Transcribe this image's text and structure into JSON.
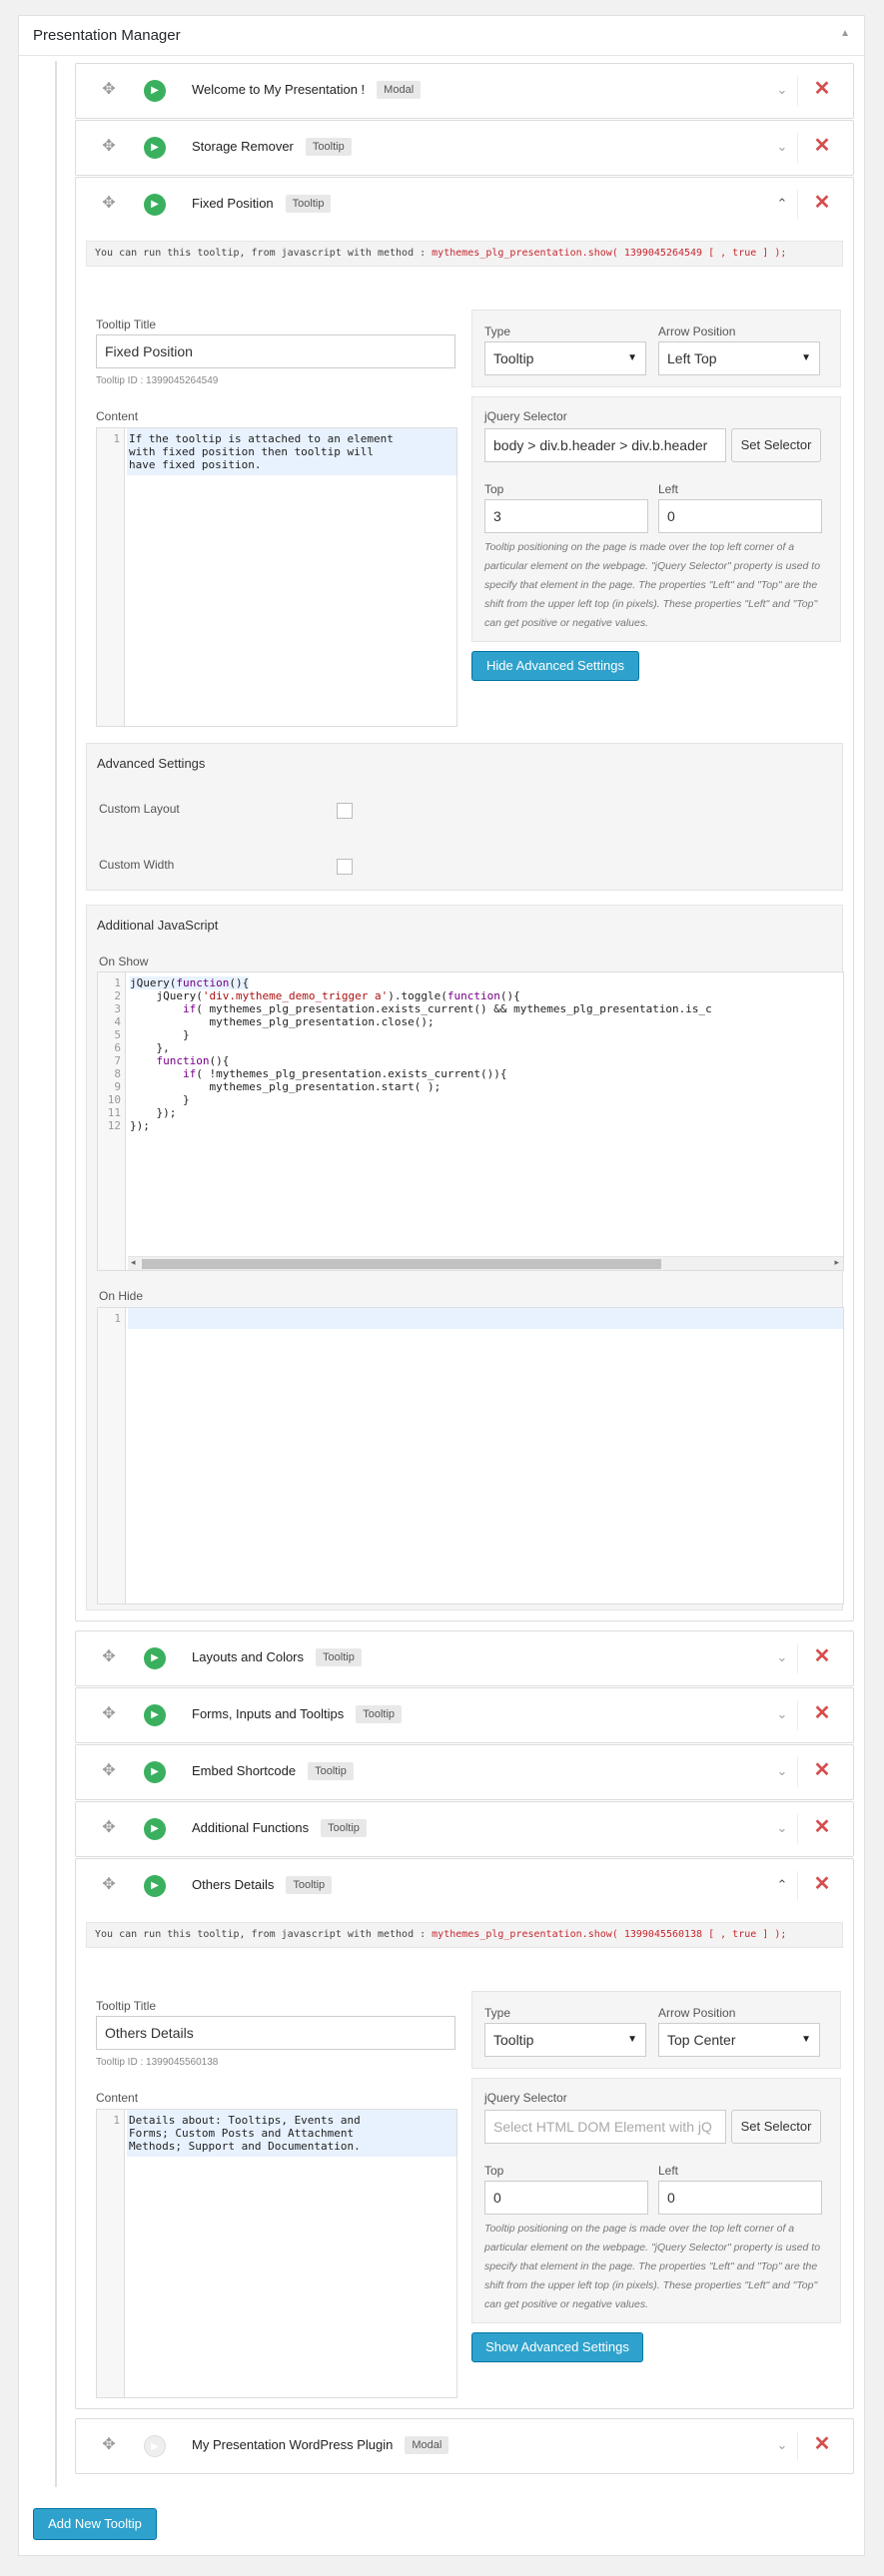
{
  "manager": {
    "title": "Presentation Manager"
  },
  "items": [
    {
      "title": "Welcome to My Presentation !",
      "badge": "Modal",
      "expanded": false,
      "enabled": true
    },
    {
      "title": "Storage Remover",
      "badge": "Tooltip",
      "expanded": false,
      "enabled": true
    },
    {
      "title": "Fixed Position",
      "badge": "Tooltip",
      "expanded": true,
      "enabled": true
    },
    {
      "title": "Layouts and Colors",
      "badge": "Tooltip",
      "expanded": false,
      "enabled": true
    },
    {
      "title": "Forms, Inputs and Tooltips",
      "badge": "Tooltip",
      "expanded": false,
      "enabled": true
    },
    {
      "title": "Embed Shortcode",
      "badge": "Tooltip",
      "expanded": false,
      "enabled": true
    },
    {
      "title": "Additional Functions",
      "badge": "Tooltip",
      "expanded": false,
      "enabled": true
    },
    {
      "title": "Others Details",
      "badge": "Tooltip",
      "expanded": true,
      "enabled": true
    },
    {
      "title": "My Presentation WordPress Plugin",
      "badge": "Modal",
      "expanded": false,
      "enabled": false
    }
  ],
  "fixed": {
    "info_prefix": "You can run this tooltip, from javascript with method : ",
    "info_method": "mythemes_plg_presentation.show( 1399045264549 [ , true ] );",
    "title_label": "Tooltip Title",
    "title_value": "Fixed Position",
    "tooltip_id": "Tooltip ID : 1399045264549",
    "content_label": "Content",
    "content_text": "If the tooltip is attached to an element\nwith fixed position then tooltip will\nhave fixed position.",
    "type_label": "Type",
    "type_value": "Tooltip",
    "arrow_label": "Arrow Position",
    "arrow_value": "Left Top",
    "selector_label": "jQuery Selector",
    "selector_value": "body > div.b.header > div.b.header",
    "set_selector": "Set Selector",
    "top_label": "Top",
    "top_value": "3",
    "left_label": "Left",
    "left_value": "0",
    "help": "Tooltip positioning on the page is made over the top left corner of a particular element on the webpage. \"jQuery Selector\" property is used to specify that element in the page. The properties \"Left\" and \"Top\" are the shift from the upper left top (in pixels). These properties \"Left\" and \"Top\" can get positive or negative values.",
    "advanced_button": "Hide Advanced Settings",
    "advanced_title": "Advanced Settings",
    "custom_layout": "Custom Layout",
    "custom_width": "Custom Width",
    "js_title": "Additional JavaScript",
    "on_show": "On Show",
    "on_hide": "On Hide"
  },
  "others": {
    "info_prefix": "You can run this tooltip, from javascript with method : ",
    "info_method": "mythemes_plg_presentation.show( 1399045560138 [ , true ] );",
    "title_label": "Tooltip Title",
    "title_value": "Others Details",
    "tooltip_id": "Tooltip ID : 1399045560138",
    "content_label": "Content",
    "content_text": "Details about: Tooltips, Events and\nForms; Custom Posts and Attachment\nMethods; Support and Documentation.",
    "type_label": "Type",
    "type_value": "Tooltip",
    "arrow_label": "Arrow Position",
    "arrow_value": "Top Center",
    "selector_label": "jQuery Selector",
    "selector_placeholder": "Select HTML DOM Element with jQ",
    "set_selector": "Set Selector",
    "top_label": "Top",
    "top_value": "0",
    "left_label": "Left",
    "left_value": "0",
    "help": "Tooltip positioning on the page is made over the top left corner of a particular element on the webpage. \"jQuery Selector\" property is used to specify that element in the page. The properties \"Left\" and \"Top\" are the shift from the upper left top (in pixels). These properties \"Left\" and \"Top\" can get positive or negative values.",
    "advanced_button": "Show Advanced Settings"
  },
  "add_button": "Add New Tooltip"
}
